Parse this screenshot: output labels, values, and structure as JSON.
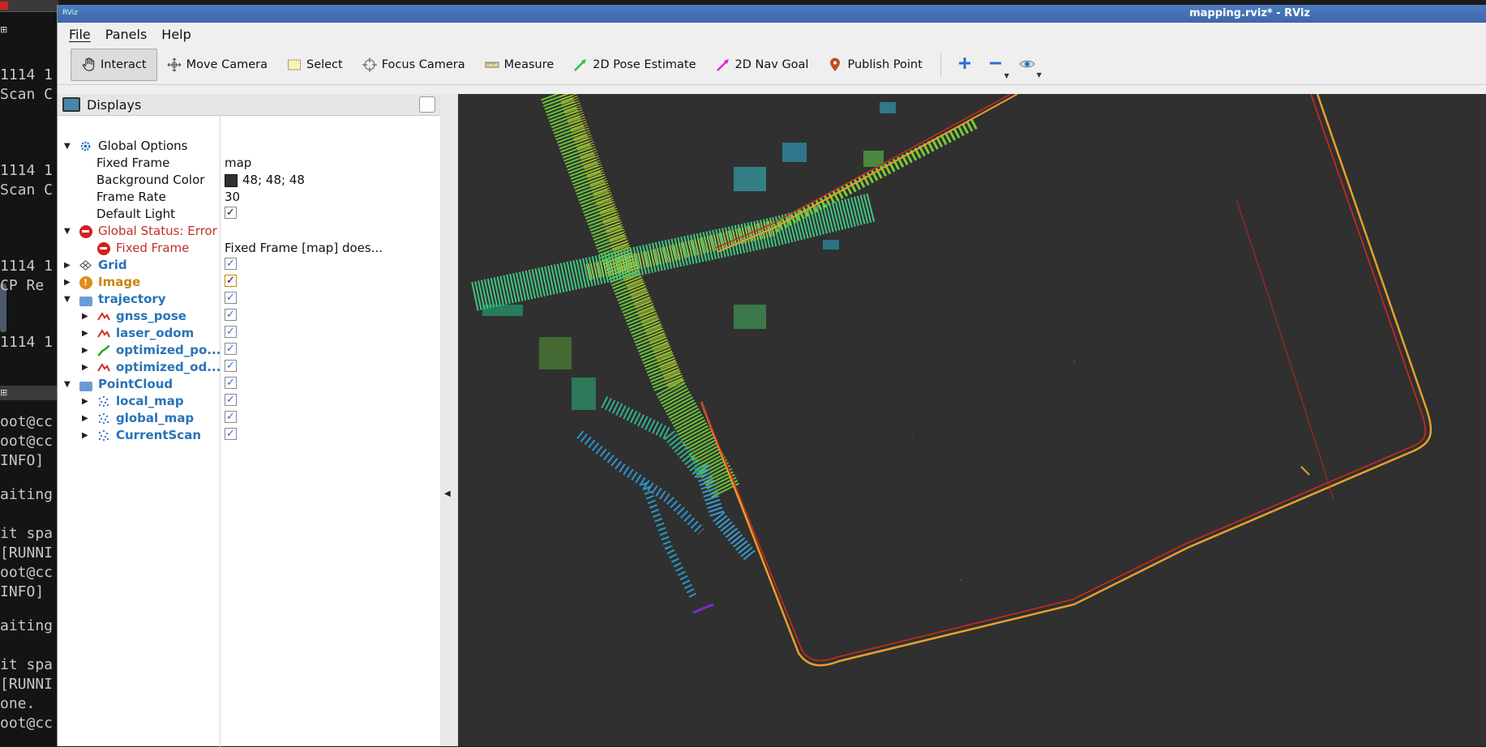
{
  "terminal": {
    "lines": [
      "1114 1",
      "Scan C",
      "1114 1",
      "Scan C",
      "1114 1",
      "CP Re",
      "1114 1",
      "oot@cc",
      "oot@cc",
      " INFO]",
      "aiting",
      "it spa",
      "[RUNNI",
      "oot@cc",
      " INFO]",
      "aiting",
      "it spa",
      "[RUNNI",
      "one.",
      "oot@cc"
    ]
  },
  "window": {
    "app_icon": "RViz",
    "title": "mapping.rviz* - RViz"
  },
  "menu": [
    "File",
    "Panels",
    "Help"
  ],
  "toolbar": {
    "tools": [
      {
        "label": "Interact",
        "icon": "hand-icon",
        "active": true
      },
      {
        "label": "Move Camera",
        "icon": "move-camera-icon"
      },
      {
        "label": "Select",
        "icon": "select-icon"
      },
      {
        "label": "Focus Camera",
        "icon": "focus-camera-icon"
      },
      {
        "label": "Measure",
        "icon": "ruler-icon"
      },
      {
        "label": "2D Pose Estimate",
        "icon": "pose-arrow-icon",
        "color": "#2ec52e"
      },
      {
        "label": "2D Nav Goal",
        "icon": "nav-arrow-icon",
        "color": "#d62ad6"
      },
      {
        "label": "Publish Point",
        "icon": "map-pin-icon",
        "color": "#c0501e"
      }
    ]
  },
  "displays": {
    "title": "Displays",
    "rows": [
      {
        "label": "Global Options"
      },
      {
        "label": "Fixed Frame",
        "value": "map"
      },
      {
        "label": "Background Color",
        "value": "48; 48; 48",
        "color": "#303030"
      },
      {
        "label": "Frame Rate",
        "value": "30"
      },
      {
        "label": "Default Light"
      },
      {
        "label": "Global Status: Error"
      },
      {
        "label": "Fixed Frame",
        "value": "Fixed Frame [map] does..."
      },
      {
        "label": "Grid"
      },
      {
        "label": "Image"
      },
      {
        "label": "trajectory"
      },
      {
        "label": "gnss_pose"
      },
      {
        "label": "laser_odom"
      },
      {
        "label": "optimized_po..."
      },
      {
        "label": "optimized_od..."
      },
      {
        "label": "PointCloud"
      },
      {
        "label": "local_map"
      },
      {
        "label": "global_map"
      },
      {
        "label": "CurrentScan"
      }
    ]
  },
  "colors": {
    "background": "#303030",
    "error": "#c0302a",
    "link_blue": "#2873b8",
    "warning": "#c8860a"
  }
}
